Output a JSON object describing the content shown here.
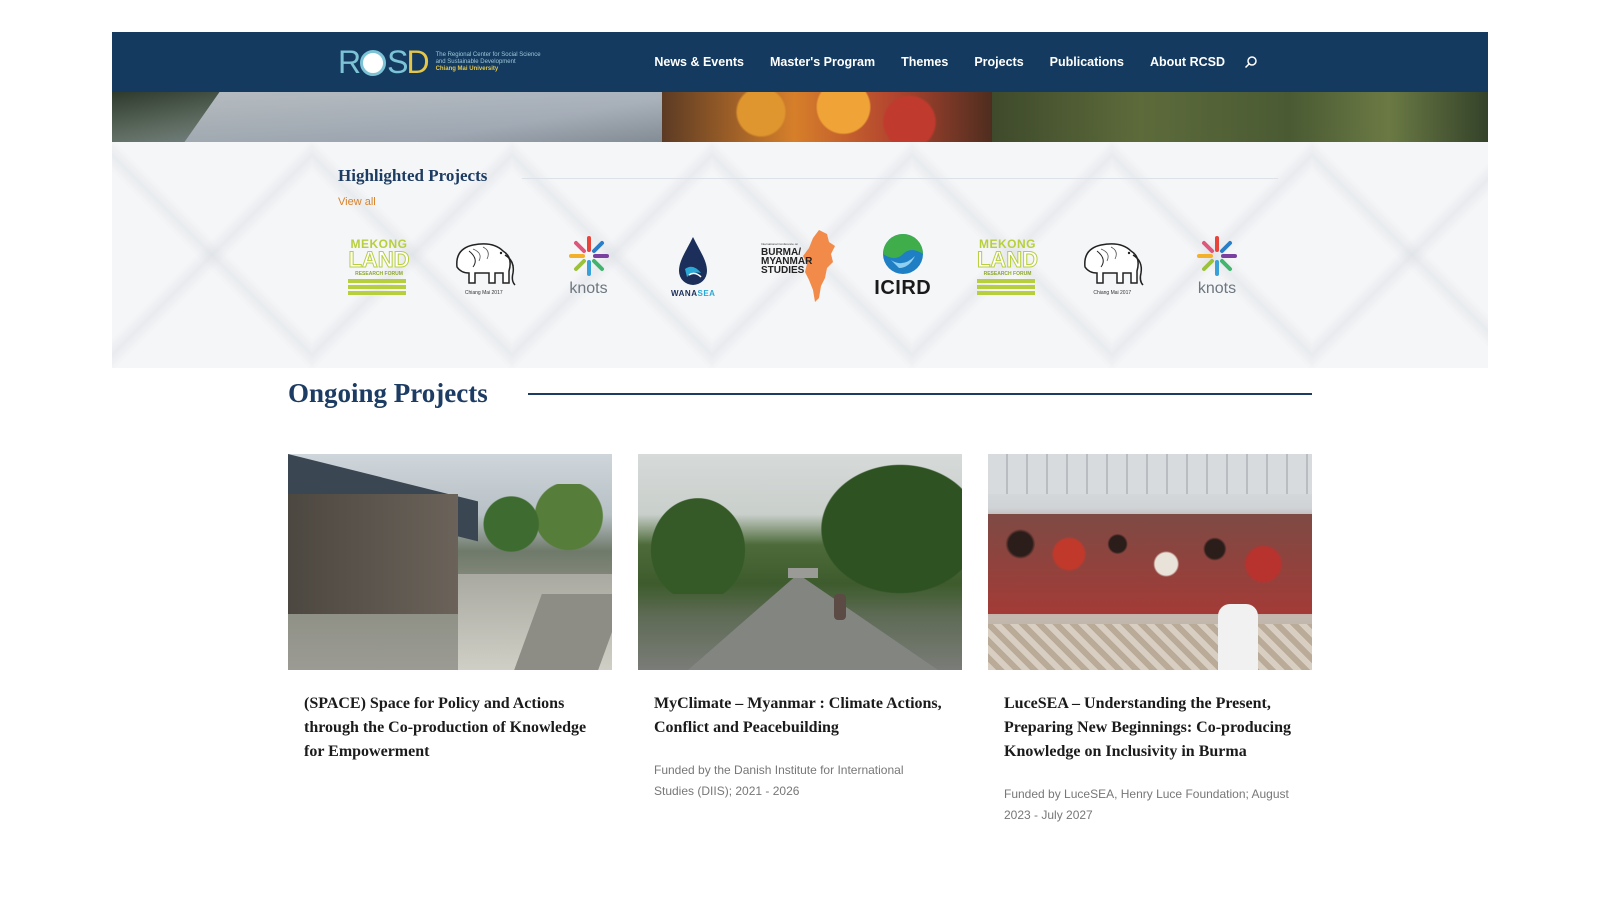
{
  "site": {
    "logo_text": "RCSD",
    "logo_subtitle_1": "The Regional Center for Social Science",
    "logo_subtitle_2": "and Sustainable Development",
    "logo_subtitle_3": "Chiang Mai University"
  },
  "nav": {
    "items": [
      {
        "label": "News & Events"
      },
      {
        "label": "Master's Program"
      },
      {
        "label": "Themes"
      },
      {
        "label": "Projects"
      },
      {
        "label": "Publications"
      },
      {
        "label": "About RCSD"
      }
    ],
    "search_icon": "search-icon"
  },
  "highlighted": {
    "title": "Highlighted Projects",
    "view_all": "View all",
    "logos": [
      {
        "name": "mekong-land-research-forum",
        "l1": "MEKONG",
        "l2": "LAND",
        "l3": "RESEARCH FORUM"
      },
      {
        "name": "elephant-conference",
        "caption": "Chiang Mai 2017"
      },
      {
        "name": "knots",
        "text": "knots"
      },
      {
        "name": "wanasea",
        "text_a": "WANA",
        "text_b": "SEA"
      },
      {
        "name": "burma-myanmar-studies",
        "small": "International Conference on",
        "text": "BURMA/ MYANMAR STUDIES"
      },
      {
        "name": "icird",
        "text": "ICIRD"
      },
      {
        "name": "mekong-land-research-forum-2",
        "l1": "MEKONG",
        "l2": "LAND",
        "l3": "RESEARCH FORUM"
      },
      {
        "name": "elephant-conference-2",
        "caption": "Chiang Mai 2017"
      },
      {
        "name": "knots-2",
        "text": "knots"
      }
    ]
  },
  "ongoing": {
    "title": "Ongoing Projects",
    "cards": [
      {
        "title": "(SPACE) Space for Policy and Actions through the Co-production of Knowledge for Empowerment",
        "meta": ""
      },
      {
        "title": "MyClimate – Myanmar : Climate Actions, Conflict and Peacebuilding",
        "meta": "Funded by the Danish Institute for International Studies (DIIS); 2021 - 2026"
      },
      {
        "title": "LuceSEA – Understanding the Present, Preparing New Beginnings: Co-producing Knowledge on Inclusivity in Burma",
        "meta": "Funded by LuceSEA, Henry Luce Foundation; August 2023 - July 2027"
      }
    ]
  },
  "colors": {
    "header_bg": "#143a5f",
    "heading": "#1d3c63",
    "accent": "#d9822b"
  }
}
